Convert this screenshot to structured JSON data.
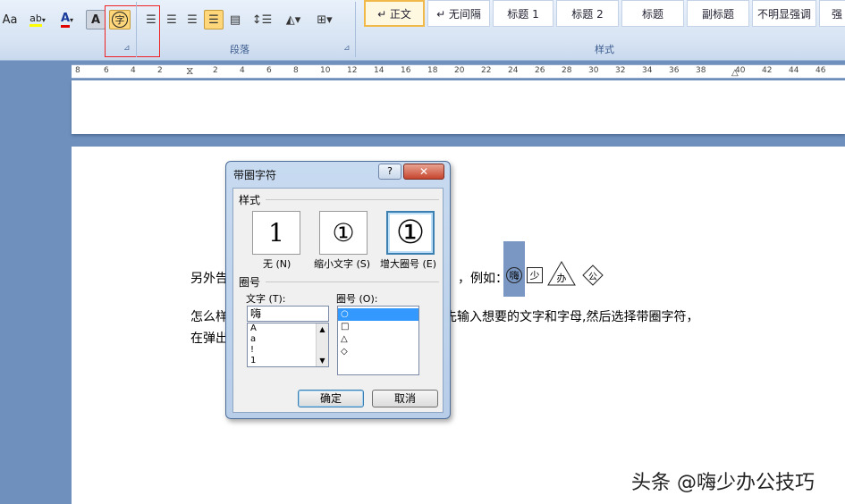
{
  "ribbon": {
    "font_row": [
      "Aa",
      "ab",
      "A",
      "A"
    ],
    "enclose_char_glyph": "字",
    "paragraph_group_label": "段落",
    "styles_group_label": "样式",
    "style_gallery": [
      {
        "label": "↵ 正文",
        "active": true
      },
      {
        "label": "↵ 无间隔",
        "active": false
      },
      {
        "label": "标题 1",
        "active": false
      },
      {
        "label": "标题 2",
        "active": false
      },
      {
        "label": "标题",
        "active": false
      },
      {
        "label": "副标题",
        "active": false
      },
      {
        "label": "不明显强调",
        "active": false
      },
      {
        "label": "强",
        "active": false
      }
    ],
    "launcher_glyph": "⊿",
    "highlight_color": "#e22222"
  },
  "ruler": {
    "ticks": [
      "8",
      "6",
      "4",
      "2",
      "2",
      "4",
      "6",
      "8",
      "10",
      "12",
      "14",
      "16",
      "18",
      "20",
      "22",
      "24",
      "26",
      "28",
      "30",
      "32",
      "34",
      "36",
      "38",
      "40",
      "42",
      "44",
      "46"
    ]
  },
  "document": {
    "line1_left": "另外告",
    "line1_right": "，例如：",
    "circled_chars": [
      "嗨",
      "少",
      "办",
      "公"
    ],
    "line2_left": "怎么样",
    "line2_right": "先输入想要的文字和字母,然后选择带圈字符，",
    "line3_left": "在弹出"
  },
  "dialog": {
    "title": "带圈字符",
    "help_label": "?",
    "close_label": "✕",
    "style_section": "样式",
    "style_options": [
      {
        "label": "无 (N)",
        "glyph": "1"
      },
      {
        "label": "缩小文字 (S)",
        "glyph": "①"
      },
      {
        "label": "增大圈号 (E)",
        "glyph": "①"
      }
    ],
    "enclosure_section": "圈号",
    "text_label": "文字 (T):",
    "text_value": "嗨",
    "text_list": [
      "A",
      "a",
      "!",
      "1"
    ],
    "enclosure_label": "圈号 (O):",
    "enclosure_list": [
      "○",
      "□",
      "△",
      "◇"
    ],
    "ok_label": "确定",
    "cancel_label": "取消"
  },
  "watermark": "头条 @嗨少办公技巧"
}
